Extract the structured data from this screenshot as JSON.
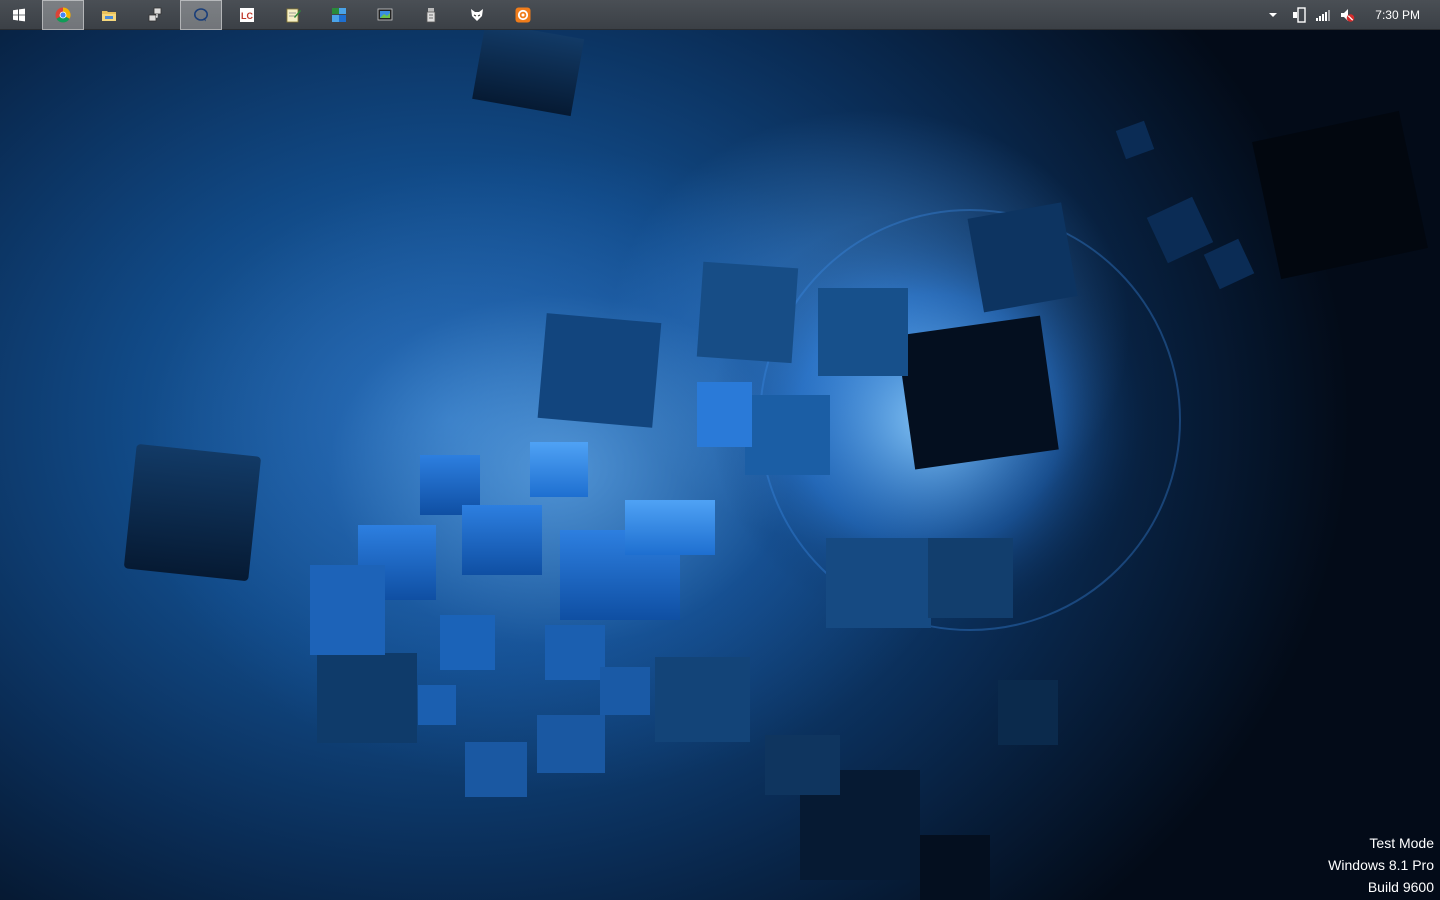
{
  "taskbar": {
    "start_icon": "windows-logo-icon",
    "pinned": [
      {
        "id": "chrome",
        "icon": "chrome-icon",
        "active": true
      },
      {
        "id": "file-explorer",
        "icon": "folder-icon",
        "active": false
      },
      {
        "id": "network-tool",
        "icon": "network-icon",
        "active": false
      },
      {
        "id": "chat",
        "icon": "chat-bubble-icon",
        "active": true
      },
      {
        "id": "lc-app",
        "icon": "lc-icon",
        "active": false
      },
      {
        "id": "notepad",
        "icon": "notepad-icon",
        "active": false
      },
      {
        "id": "remote-desktop",
        "icon": "remote-desktop-icon",
        "active": false
      },
      {
        "id": "screen-capture",
        "icon": "screenshot-icon",
        "active": false
      },
      {
        "id": "usb-tool",
        "icon": "usb-drive-icon",
        "active": false
      },
      {
        "id": "fox-app",
        "icon": "fox-icon",
        "active": false
      },
      {
        "id": "orange-app",
        "icon": "orange-circle-icon",
        "active": false
      }
    ],
    "tray": {
      "overflow_icon": "chevron-up-icon",
      "device_icon": "device-icon",
      "signal_icon": "signal-bars-icon",
      "volume_icon": "volume-muted-icon"
    },
    "clock": "7:30 PM"
  },
  "watermark": {
    "line1": "Test Mode",
    "line2": "Windows 8.1 Pro",
    "line3": "Build 9600"
  },
  "colors": {
    "taskbar_bg": "#3f444a",
    "accent_blue": "#1e6fd0",
    "wallpaper_dark": "#030b18"
  }
}
